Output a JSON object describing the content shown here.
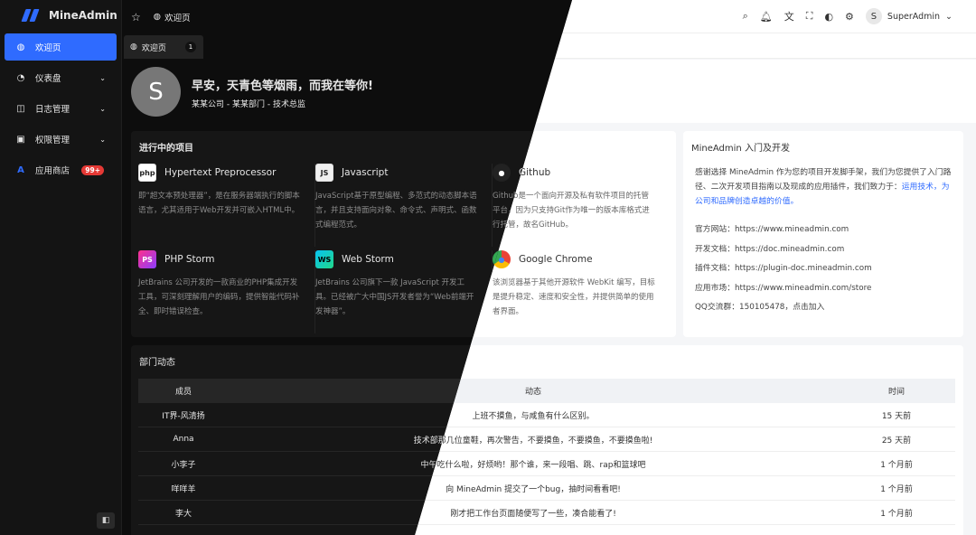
{
  "app": {
    "name": "MineAdmin"
  },
  "sidebar": {
    "items": [
      {
        "label": "欢迎页",
        "icon": "dashboard-icon"
      },
      {
        "label": "仪表盘",
        "icon": "gauge-icon"
      },
      {
        "label": "日志管理",
        "icon": "log-icon"
      },
      {
        "label": "权限管理",
        "icon": "lock-icon"
      },
      {
        "label": "应用商店",
        "icon": "store-icon",
        "badge": "99+"
      }
    ],
    "collapse_icon": "sidebar-collapse-icon"
  },
  "topbar": {
    "breadcrumb": "欢迎页",
    "user_initial": "S",
    "user_name": "SuperAdmin"
  },
  "tabs": [
    {
      "label": "欢迎页",
      "count": "1"
    }
  ],
  "hero": {
    "avatar_initial": "S",
    "greeting": "早安，天青色等烟雨，而我在等你!",
    "org": "某某公司 - 某某部门 - 技术总监"
  },
  "projects": {
    "title": "进行中的项目",
    "items": [
      {
        "name": "Hypertext Preprocessor",
        "badge": "php",
        "desc": "即“超文本预处理器”，是在服务器端执行的脚本语言，尤其适用于Web开发并可嵌入HTML中。"
      },
      {
        "name": "Javascript",
        "badge": "JS",
        "desc": "JavaScript基于原型编程、多范式的动态脚本语言，并且支持面向对象、命令式、声明式、函数式编程范式。"
      },
      {
        "name": "Github",
        "badge": "GH",
        "desc": "Github是一个面向开源及私有软件项目的托管平台，因为只支持Git作为唯一的版本库格式进行托管，故名GitHub。"
      },
      {
        "name": "PHP Storm",
        "badge": "PS",
        "desc": "JetBrains 公司开发的一款商业的PHP集成开发工具，可深刻理解用户的编码，提供智能代码补全、即时错误检查。"
      },
      {
        "name": "Web Storm",
        "badge": "WS",
        "desc": "JetBrains 公司旗下一款 JavaScript 开发工具。已经被广大中国JS开发者誉为“Web前端开发神器”。"
      },
      {
        "name": "Google Chrome",
        "badge": "GC",
        "desc": "该浏览器基于其他开源软件 WebKit 编写，目标是提升稳定、速度和安全性，并提供简单的使用者界面。"
      }
    ]
  },
  "intro": {
    "title": "MineAdmin 入门及开发",
    "text_a": "感谢选择 MineAdmin 作为您的项目开发脚手架，我们为您提供了入门路径、二次开发项目指南以及现成的应用插件，我们致力于：",
    "text_link": "运用技术，为公司和品牌创造卓越的价值。",
    "rows": [
      "官方网站：https://www.mineadmin.com",
      "开发文档：https://doc.mineadmin.com",
      "插件文档：https://plugin-doc.mineadmin.com",
      "应用市场：https://www.mineadmin.com/store",
      "QQ交流群：150105478，点击加入"
    ]
  },
  "dept": {
    "title": "部门动态",
    "headers": [
      "成员",
      "动态",
      "时间"
    ],
    "rows": [
      {
        "member": "IT界-风清扬",
        "activity": "上班不摸鱼，与咸鱼有什么区别。",
        "time": "15 天前"
      },
      {
        "member": "Anna",
        "activity": "技术部那几位童鞋，再次警告，不要摸鱼，不要摸鱼，不要摸鱼啦!",
        "time": "25 天前"
      },
      {
        "member": "小李子",
        "activity": "中午吃什么啦，好烦哟！那个谁，来一段唱、跳、rap和篮球吧",
        "time": "1 个月前"
      },
      {
        "member": "咩咩羊",
        "activity": "向 MineAdmin 提交了一个bug，抽时间看看吧!",
        "time": "1 个月前"
      },
      {
        "member": "李大",
        "activity": "刚才把工作台页面随便写了一些，凑合能看了!",
        "time": "1 个月前"
      }
    ]
  }
}
